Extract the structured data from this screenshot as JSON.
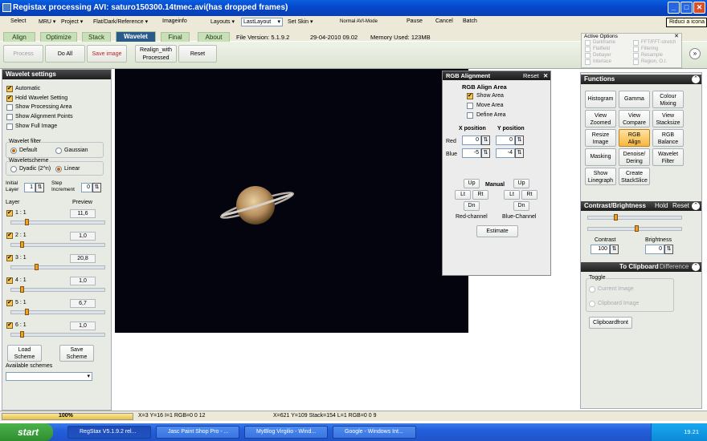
{
  "window": {
    "title": "Registax processing AVI: saturo150300.14tmec.avi(has dropped frames)",
    "tooltip": "Riduci a icona",
    "min_glyph": "_",
    "max_glyph": "□",
    "close_glyph": "✕"
  },
  "menu": {
    "select": "Select",
    "mru": "MRU ▾",
    "project": "Project ▾",
    "flat": "Flat/Dark/Reference ▾",
    "imageinfo": "Imageinfo",
    "layouts": "Layouts ▾",
    "layout_value": "LastLayout",
    "skin": "Set Skin ▾",
    "avi_mode": "Normal AVI-Mode",
    "pause": "Pause",
    "cancel": "Cancel",
    "batch": "Batch"
  },
  "tabs": [
    "Align",
    "Optimize",
    "Stack",
    "Wavelet",
    "Final",
    "About"
  ],
  "active_tab": "Wavelet",
  "info": {
    "version": "File Version: 5.1.9.2",
    "date": "29-04-2010 09.02",
    "memory": "Memory Used: 123MB"
  },
  "toolbar": {
    "process": "Process",
    "doall": "Do All",
    "saveimage": "Save image",
    "realign_1": "Realign_with",
    "realign_2": "Processed",
    "reset": "Reset"
  },
  "wavelet": {
    "header": "Wavelet settings",
    "automatic": "Automatic",
    "hold": "Hold Wavelet Setting",
    "show_area": "Show Processing Area",
    "show_points": "Show Alignment Points",
    "show_full": "Show Full Image",
    "filter_label": "Wavelet filter",
    "default": "Default",
    "gaussian": "Gaussian",
    "scheme_label": "Waveletscheme",
    "dyadic": "Dyadic (2^n)",
    "linear": "Linear",
    "initial_1": "Initial",
    "initial_2": "Layer",
    "initial_val": "1",
    "step_1": "Step",
    "step_2": "Increment",
    "step_val": "0",
    "col_layer": "Layer",
    "col_preview": "Preview",
    "layers": [
      {
        "name": "1 : 1",
        "value": "11,6",
        "slider": 0.1
      },
      {
        "name": "2 : 1",
        "value": "1,0",
        "slider": 0.05
      },
      {
        "name": "3 : 1",
        "value": "20,8",
        "slider": 0.2
      },
      {
        "name": "4 : 1",
        "value": "1,0",
        "slider": 0.05
      },
      {
        "name": "5 : 1",
        "value": "6,7",
        "slider": 0.1
      },
      {
        "name": "6 : 1",
        "value": "1,0",
        "slider": 0.05
      }
    ],
    "load_1": "Load",
    "load_2": "Scheme",
    "save_1": "Save",
    "save_2": "Scheme",
    "available": "Available schemes"
  },
  "rgb": {
    "title": "RGB Alignment",
    "reset": "Reset",
    "close": "✕",
    "area_title": "RGB Align Area",
    "show_area": "Show Area",
    "move_area": "Move Area",
    "define_area": "Define Area",
    "xpos": "X position",
    "ypos": "Y position",
    "red": "Red",
    "blue": "Blue",
    "red_x": "0",
    "red_y": "0",
    "blue_x": "-5",
    "blue_y": "-4",
    "manual": "Manual",
    "up": "Up",
    "lt": "Lt",
    "rt": "Rt",
    "dn": "Dn",
    "red_channel": "Red-channel",
    "blue_channel": "Blue-Channel",
    "estimate": "Estimate"
  },
  "options": {
    "title": "Active Options",
    "close": "✕",
    "items": [
      "Darkframe",
      "Flatfield",
      "Debayer",
      "Interlace",
      "FFT/FFT-stretch",
      "Filtering",
      "Resample",
      "Region, O.I."
    ]
  },
  "functions": {
    "title": "Functions",
    "collapse": "⌃",
    "buttons": [
      [
        "Histogram"
      ],
      [
        "Gamma"
      ],
      [
        "Colour",
        "Mixing"
      ],
      [
        "View",
        "Zoomed"
      ],
      [
        "View",
        "Compare"
      ],
      [
        "View",
        "Stacksize"
      ],
      [
        "Resize",
        "Image"
      ],
      [
        "RGB",
        "Align"
      ],
      [
        "RGB",
        "Balance"
      ],
      [
        "Masking"
      ],
      [
        "Denoise/",
        "Dering"
      ],
      [
        "Wavelet",
        "Filter"
      ],
      [
        "Show",
        "Linegraph"
      ],
      [
        "Create",
        "StackSlice"
      ]
    ]
  },
  "contrast": {
    "title": "Contrast/Brightness",
    "hold": "Hold",
    "reset": "Reset",
    "contrast_label": "Contrast",
    "contrast_val": "100",
    "contrast_slider": 0.28,
    "brightness_label": "Brightness",
    "brightness_val": "0",
    "brightness_slider": 0.5
  },
  "clipboard": {
    "to_clipboard": "To Clipboard",
    "difference": "Difference",
    "toggle": "Toggle",
    "current": "Current Image",
    "clipboard_image": "Clipboard Image",
    "front": "Clipboardfront"
  },
  "status": {
    "progress": "100%",
    "progress_fraction": 1.0,
    "left": "X=3 Y=16 I=1 RGB=0 0 12",
    "right": "X=621 Y=109 Stack=154 L=1 RGB=0 0 9"
  },
  "taskbar": {
    "start": "start",
    "tasks": [
      "RegStax V5.1.9.2 rel...",
      "Jasc Paint Shop Pro - ...",
      "MyBlog Virgilio - Wind...",
      "Google - Windows Int..."
    ],
    "clock": "19.21"
  },
  "colors": {
    "accent": "#2a5a8a",
    "title_blue": "#0546c8",
    "highlight": "#f6b840",
    "canvas": "#04040e"
  }
}
